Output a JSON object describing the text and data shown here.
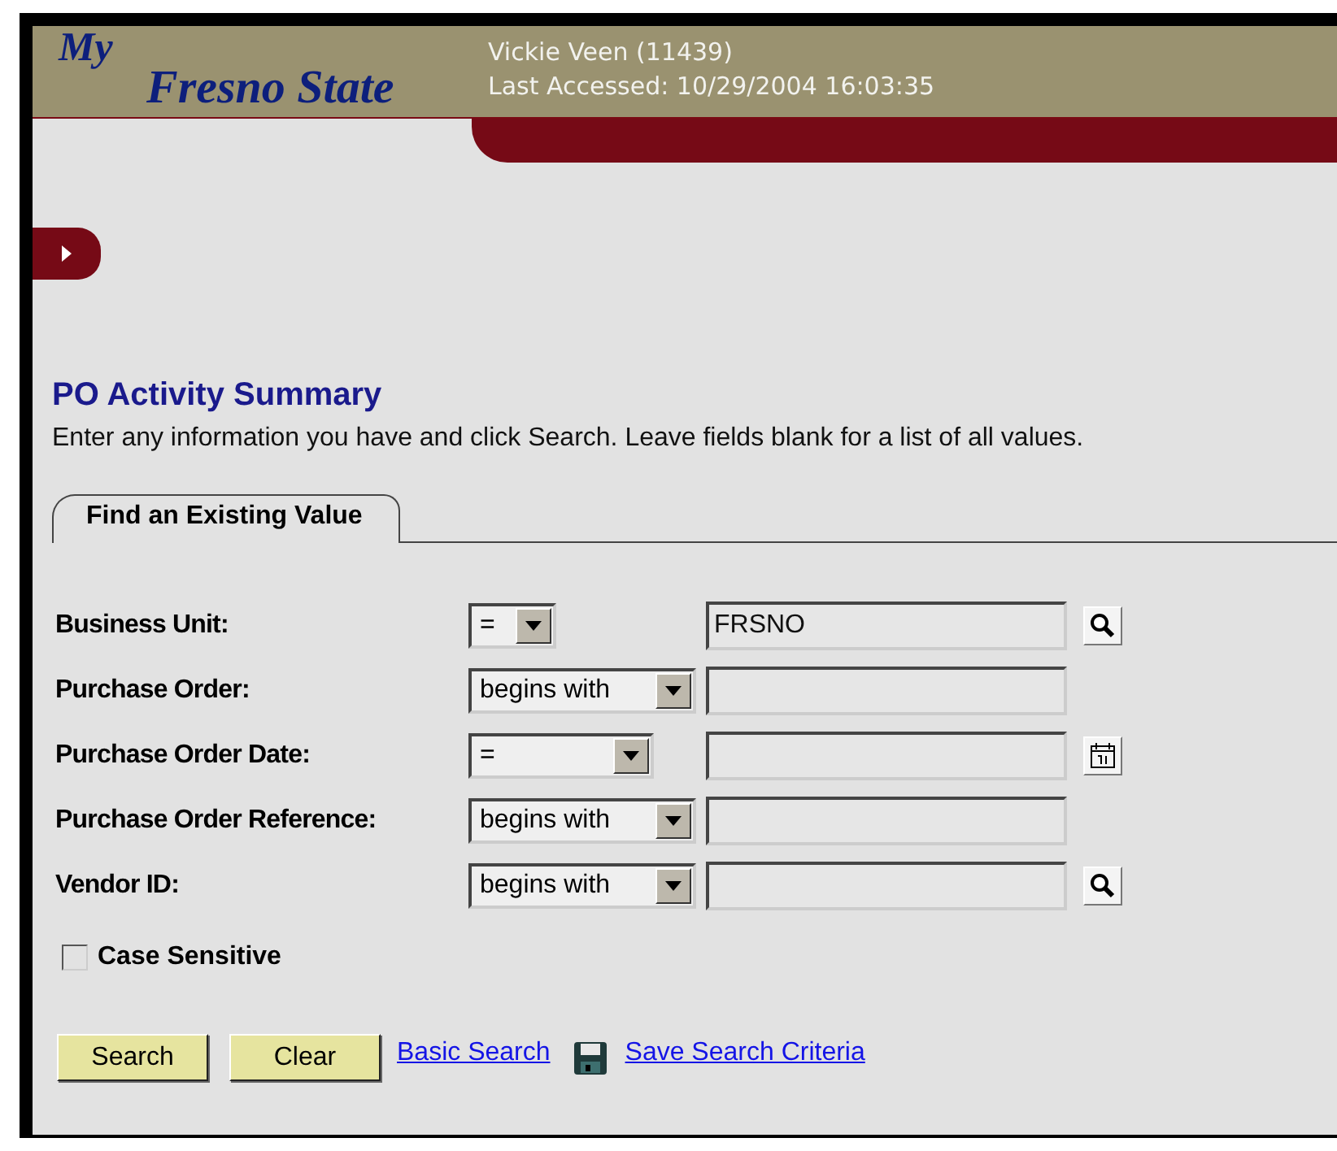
{
  "header": {
    "logo_top": "My",
    "logo_bottom": "Fresno State",
    "user": "Vickie Veen (11439)",
    "last_accessed": "Last Accessed: 10/29/2004 16:03:35"
  },
  "page": {
    "title": "PO Activity Summary",
    "instructions": "Enter any information you have and click Search. Leave fields blank for a list of all values."
  },
  "tabs": [
    {
      "label": "Find an Existing Value",
      "selected": true
    }
  ],
  "fields": [
    {
      "label": "Business Unit:",
      "operator": "=",
      "value": "FRSNO",
      "kind": "lookup"
    },
    {
      "label": "Purchase Order:",
      "operator": "begins with",
      "kind": "plain"
    },
    {
      "label": "Purchase Order Date:",
      "operator": "=",
      "kind": "calendar"
    },
    {
      "label": "Purchase Order Reference:",
      "operator": "begins with",
      "kind": "plain"
    },
    {
      "label": "Vendor ID:",
      "operator": "begins with",
      "kind": "lookup"
    }
  ],
  "case_sensitive": {
    "label": "Case Sensitive",
    "checked": false
  },
  "buttons": [
    "Search",
    "Clear"
  ],
  "links": [
    {
      "label": "Basic Search",
      "kind": "plain"
    },
    {
      "label": "Save Search Criteria",
      "kind": "save"
    }
  ]
}
